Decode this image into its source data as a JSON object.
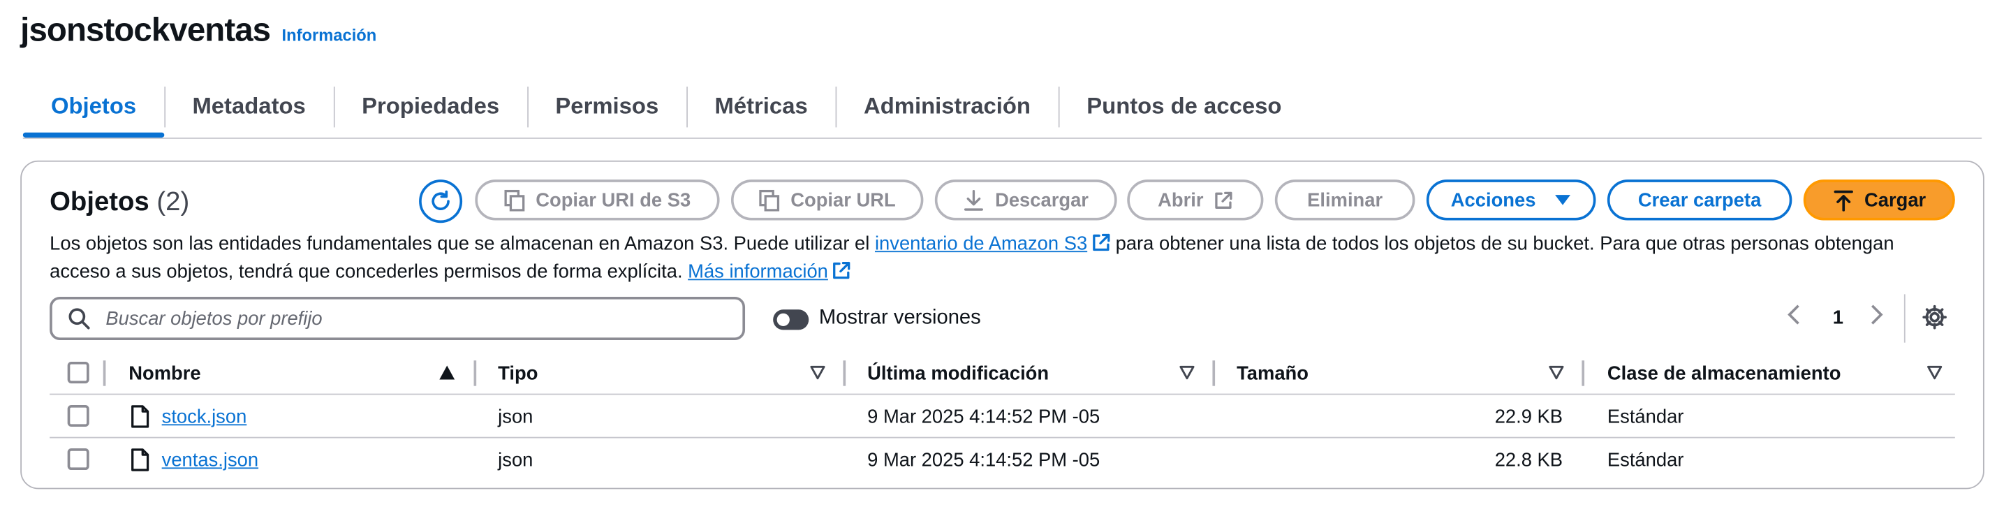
{
  "header": {
    "bucket_name": "jsonstockventas",
    "info_link": "Información"
  },
  "tabs": [
    {
      "label": "Objetos",
      "active": true
    },
    {
      "label": "Metadatos"
    },
    {
      "label": "Propiedades"
    },
    {
      "label": "Permisos"
    },
    {
      "label": "Métricas"
    },
    {
      "label": "Administración"
    },
    {
      "label": "Puntos de acceso"
    }
  ],
  "objects_panel": {
    "title": "Objetos",
    "count": "(2)",
    "buttons": {
      "copy_s3_uri": "Copiar URI de S3",
      "copy_url": "Copiar URL",
      "download": "Descargar",
      "open": "Abrir",
      "delete": "Eliminar",
      "actions": "Acciones",
      "create_folder": "Crear carpeta",
      "upload": "Cargar"
    },
    "description": {
      "part1": "Los objetos son las entidades fundamentales que se almacenan en Amazon S3. Puede utilizar el ",
      "inventory_link": "inventario de Amazon S3",
      "part2": " para obtener una lista de todos los objetos de su bucket. Para que otras personas obtengan acceso a sus objetos, tendrá que concederles permisos de forma explícita. ",
      "more_link": "Más información"
    },
    "search": {
      "placeholder": "Buscar objetos por prefijo",
      "value": ""
    },
    "show_versions_label": "Mostrar versiones",
    "show_versions": false,
    "pagination": {
      "current_page": "1"
    },
    "columns": [
      "Nombre",
      "Tipo",
      "Última modificación",
      "Tamaño",
      "Clase de almacenamiento"
    ],
    "rows": [
      {
        "name": "stock.json",
        "type": "json",
        "modified": "9 Mar 2025 4:14:52 PM -05",
        "size": "22.9 KB",
        "storage_class": "Estándar"
      },
      {
        "name": "ventas.json",
        "type": "json",
        "modified": "9 Mar 2025 4:14:52 PM -05",
        "size": "22.8 KB",
        "storage_class": "Estándar"
      }
    ]
  },
  "colors": {
    "link": "#0972d3",
    "primary": "#f89c2b",
    "disabled": "#8c8c94",
    "text": "#0f141a"
  }
}
